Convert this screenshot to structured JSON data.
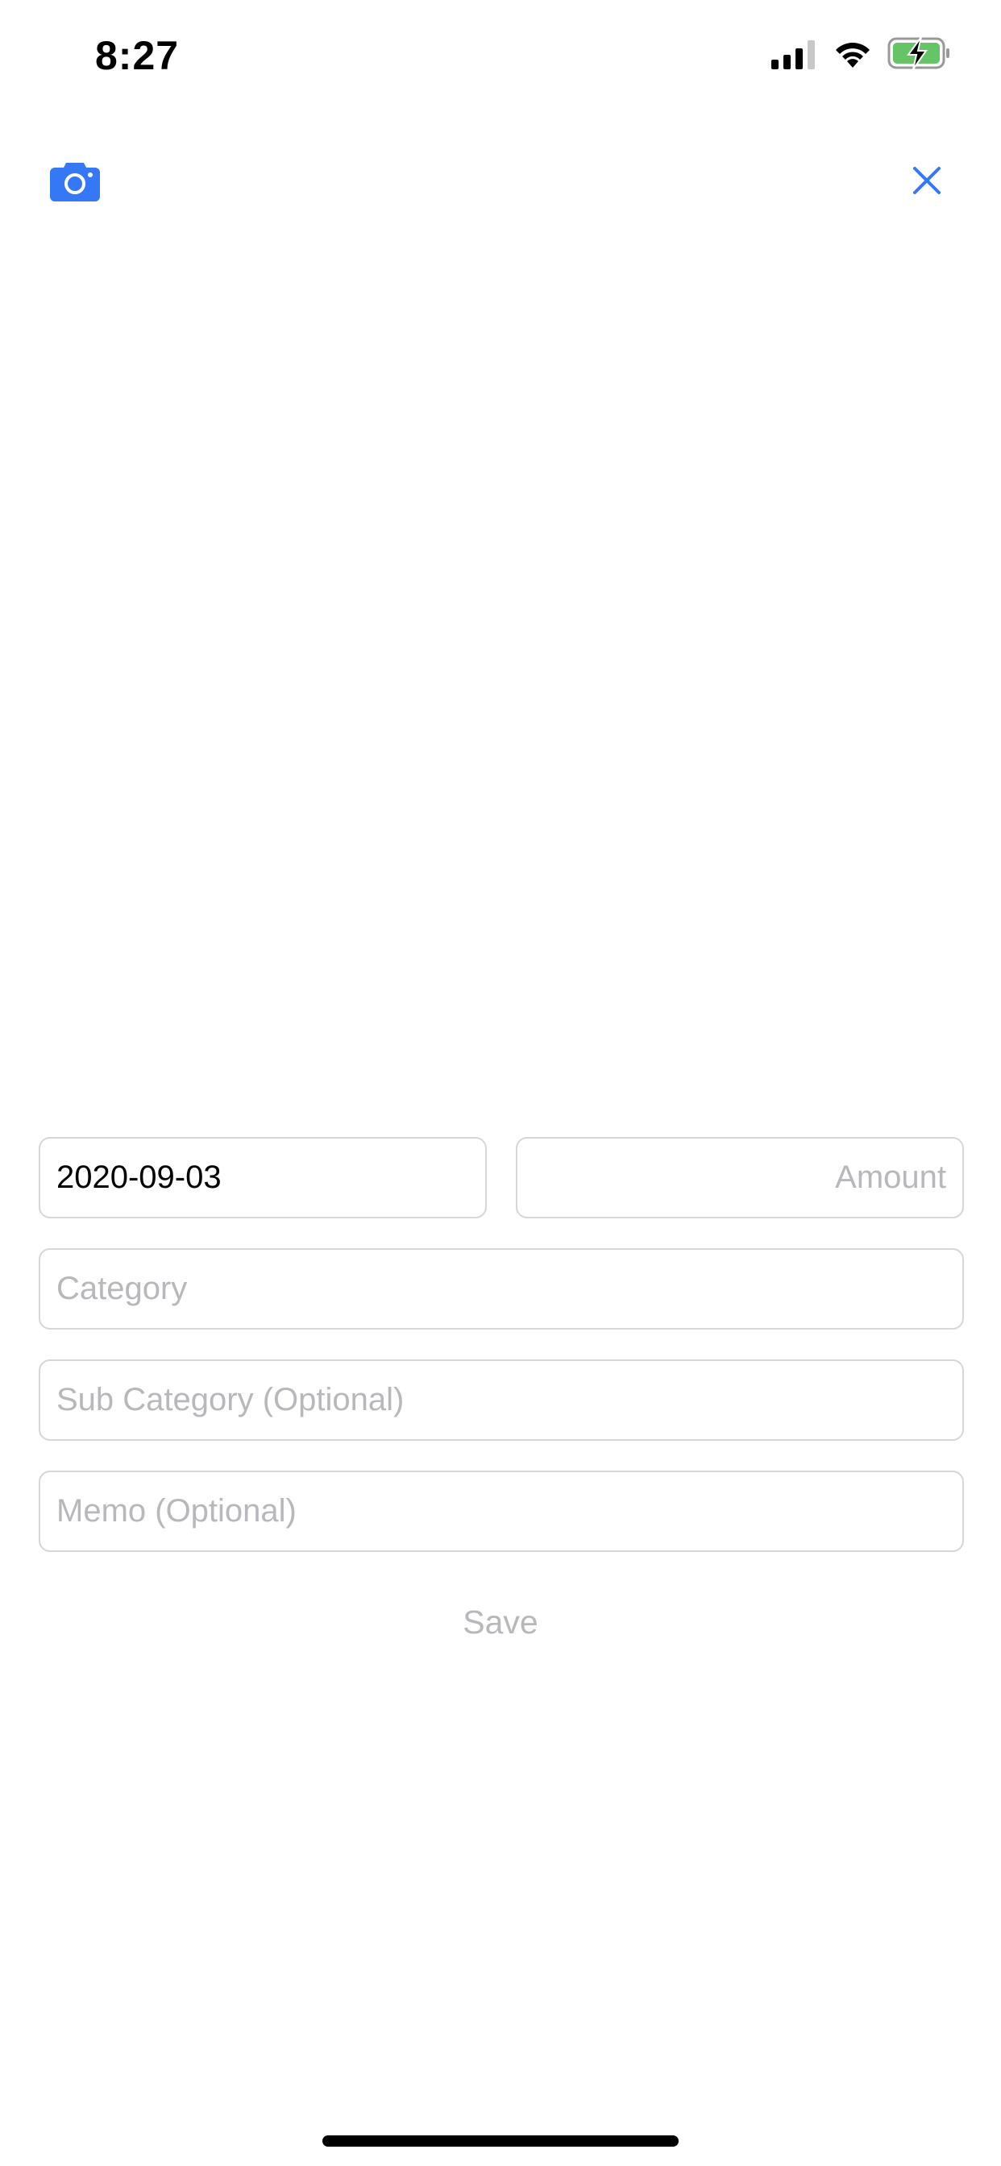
{
  "status_bar": {
    "time": "8:27",
    "signal_icon": "cellular-signal-icon",
    "wifi_icon": "wifi-icon",
    "battery_icon": "battery-charging-icon",
    "battery_color": "#65c466"
  },
  "header": {
    "camera_icon": "camera-icon",
    "close_icon": "close-icon",
    "accent_color": "#3478f6"
  },
  "form": {
    "date": {
      "value": "2020-09-03"
    },
    "amount": {
      "value": "",
      "placeholder": "Amount"
    },
    "category": {
      "value": "",
      "placeholder": "Category"
    },
    "sub_category": {
      "value": "",
      "placeholder": "Sub Category (Optional)"
    },
    "memo": {
      "value": "",
      "placeholder": "Memo (Optional)"
    },
    "save_label": "Save"
  }
}
